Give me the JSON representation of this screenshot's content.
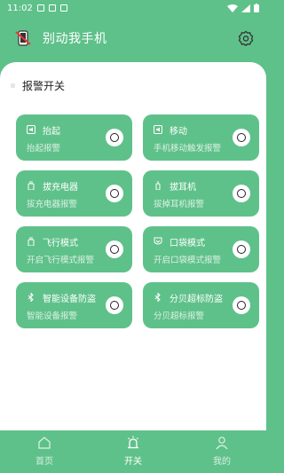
{
  "status_bar": {
    "time": "11:02"
  },
  "app": {
    "title": "别动我手机"
  },
  "section": {
    "label": "报警开关"
  },
  "cards": [
    {
      "icon": "lift-icon",
      "title": "抬起",
      "subtitle": "抬起报警"
    },
    {
      "icon": "move-icon",
      "title": "移动",
      "subtitle": "手机移动触发报警"
    },
    {
      "icon": "charger-icon",
      "title": "拔充电器",
      "subtitle": "拔充电器报警"
    },
    {
      "icon": "earphone-icon",
      "title": "拔耳机",
      "subtitle": "拔掉耳机报警"
    },
    {
      "icon": "airplane-icon",
      "title": "飞行模式",
      "subtitle": "开启飞行模式报警"
    },
    {
      "icon": "pocket-icon",
      "title": "口袋模式",
      "subtitle": "开启口袋模式报警"
    },
    {
      "icon": "bluetooth-icon",
      "title": "智能设备防盗",
      "subtitle": "智能设备报警"
    },
    {
      "icon": "bluetooth-icon",
      "title": "分贝超标防盗",
      "subtitle": "分贝超标报警"
    }
  ],
  "nav": {
    "items": [
      {
        "label": "首页",
        "icon": "home-icon",
        "active": false
      },
      {
        "label": "开关",
        "icon": "alarm-icon",
        "active": true
      },
      {
        "label": "我的",
        "icon": "profile-icon",
        "active": false
      }
    ]
  }
}
